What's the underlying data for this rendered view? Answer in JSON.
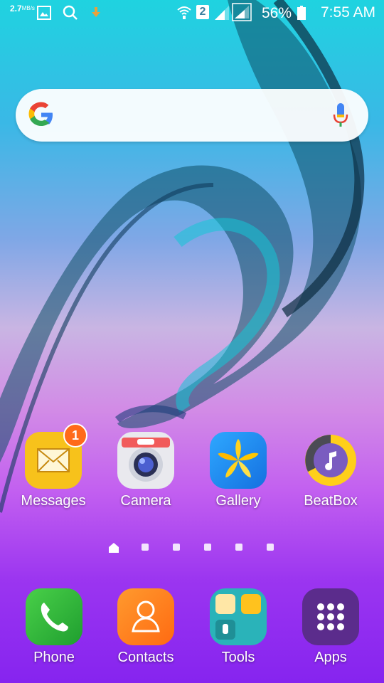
{
  "status_bar": {
    "speed_value": "2.7",
    "speed_unit": "MB/s",
    "sim_slot": "2",
    "battery": "56%",
    "time": "7:55 AM",
    "icons": [
      "image-icon",
      "search-icon",
      "download-icon",
      "wifi-icon",
      "sim-icon",
      "signal-icon",
      "signal-icon",
      "battery-icon"
    ]
  },
  "search": {
    "logo": "G",
    "placeholder": ""
  },
  "home_apps": [
    {
      "label": "Messages",
      "badge": "1"
    },
    {
      "label": "Camera"
    },
    {
      "label": "Gallery"
    },
    {
      "label": "BeatBox"
    }
  ],
  "dock_apps": [
    {
      "label": "Phone"
    },
    {
      "label": "Contacts"
    },
    {
      "label": "Tools"
    },
    {
      "label": "Apps"
    }
  ],
  "page_indicator": {
    "pages": 6,
    "current": 0
  },
  "colors": {
    "badge": "#ff6a1a",
    "messages": "#f7c21b",
    "gallery": "#1f8ff0",
    "phone": "#2fbe3b",
    "contacts": "#ff7d1e",
    "tools": "#2ab3b9",
    "apps": "#5b2c8c"
  }
}
